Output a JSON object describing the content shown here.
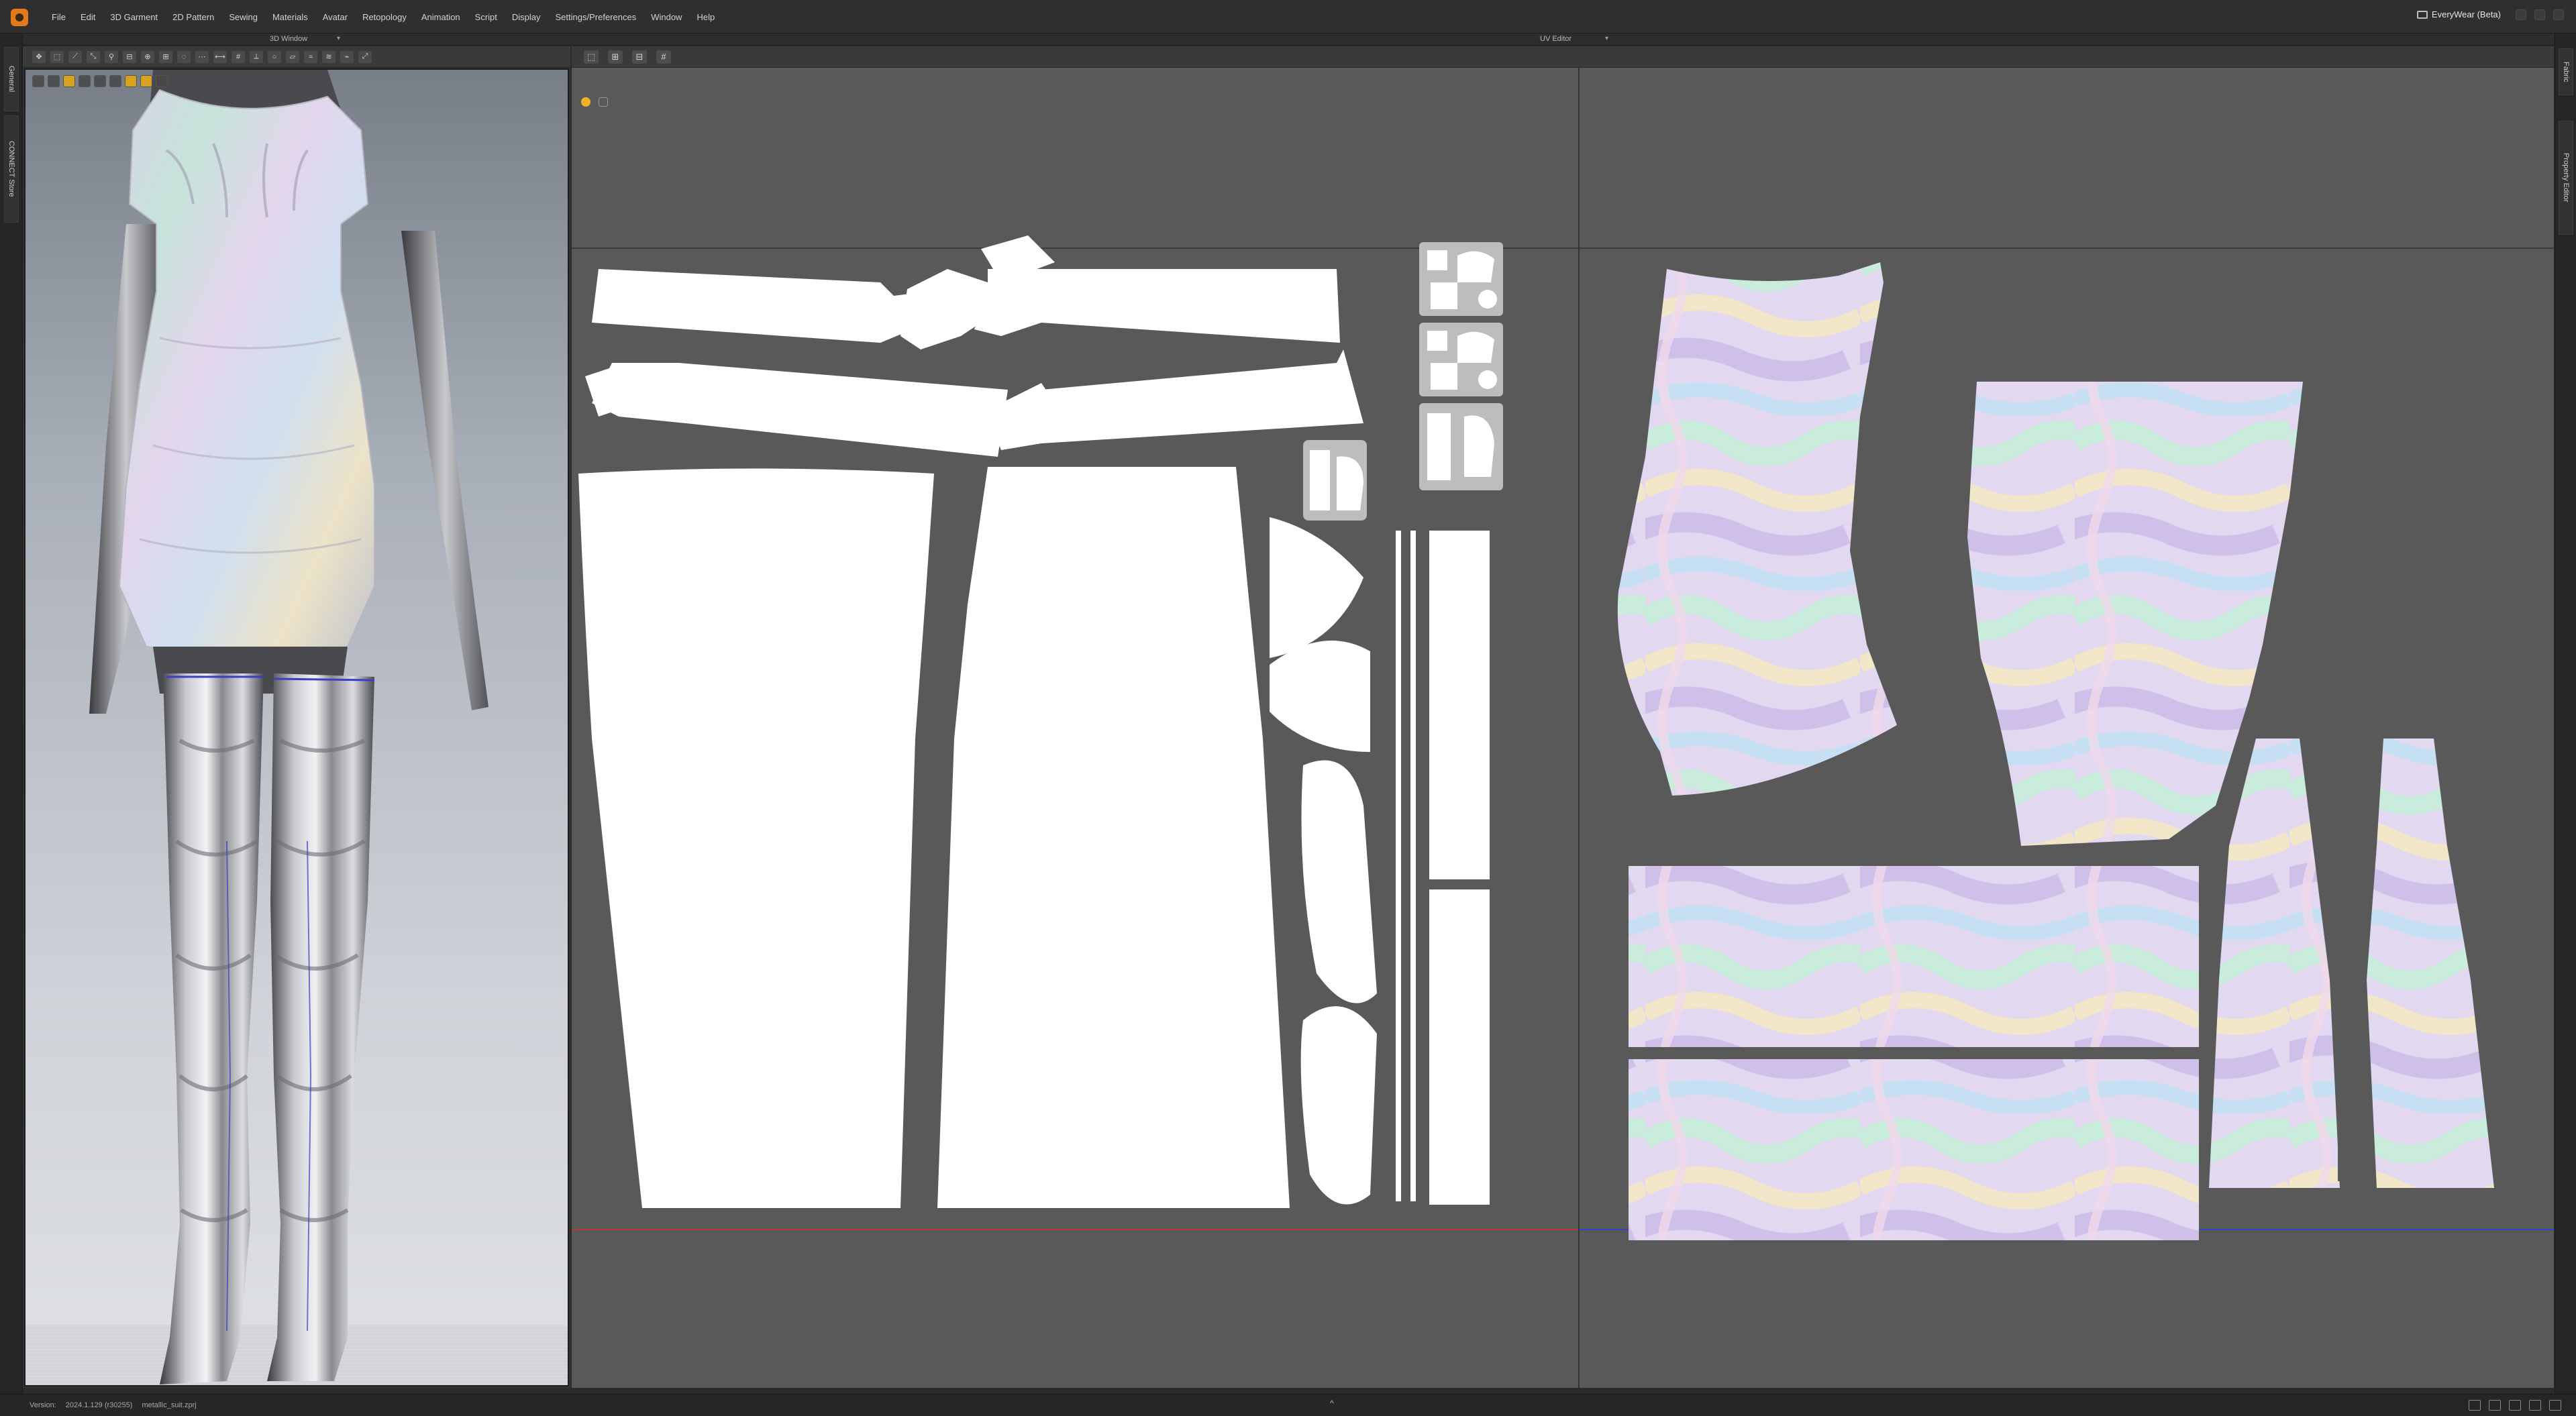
{
  "menubar": {
    "items": [
      "File",
      "Edit",
      "3D Garment",
      "2D Pattern",
      "Sewing",
      "Materials",
      "Avatar",
      "Retopology",
      "Animation",
      "Script",
      "Display",
      "Settings/Preferences",
      "Window",
      "Help"
    ],
    "everywear_label": "EveryWear (Beta)"
  },
  "panels": {
    "window_3d_title": "3D Window",
    "uv_editor_title": "UV Editor"
  },
  "side_tabs": {
    "left": [
      "General",
      "CONNECT Store"
    ],
    "right": [
      "Fabric",
      "Property Editor"
    ]
  },
  "toolbar_3d": {
    "icons": [
      "move-icon",
      "select-icon",
      "fold-icon",
      "fold-arrange-icon",
      "tack-icon",
      "lock-icon",
      "pin-icon",
      "pin-box-icon",
      "pin-lasso-icon",
      "sew-icon",
      "measure-icon",
      "grid-icon",
      "ruler-icon",
      "circ-ruler-icon",
      "flat-icon",
      "puckering-icon",
      "shirring-icon",
      "strap-icon",
      "fit-icon"
    ]
  },
  "viewport": {
    "icons": [
      "display-icon",
      "avatar-display-icon",
      "texture-icon",
      "fabric-display-icon",
      "light-icon",
      "sun-icon",
      "render-icon",
      "camera-icon",
      "fullscreen-icon"
    ]
  },
  "toolbar_uv": {
    "icons": [
      "uv-transform-icon",
      "uv-edit-icon",
      "uv-arrange-icon",
      "uv-pin-icon"
    ]
  },
  "statusbar": {
    "version_label": "Version:",
    "version_value": "2024.1.129 (r30255)",
    "file_name": "metallic_suit.zprj",
    "caret": "^"
  },
  "colors": {
    "uv_background": "#595959",
    "divider": "#343434",
    "red_axis": "#b33a3a",
    "blue_axis": "#3b3fc4",
    "accent": "#e07a1a"
  }
}
